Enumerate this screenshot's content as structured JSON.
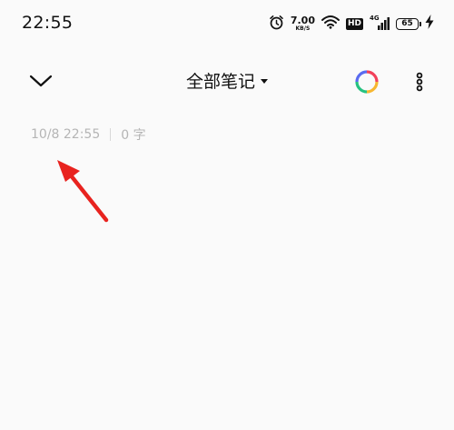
{
  "status_bar": {
    "time": "22:55",
    "net_speed_value": "7.00",
    "net_speed_unit": "KB/S",
    "hd_label": "HD",
    "signal_label": "4G",
    "battery_level": "65",
    "icons": [
      "alarm-icon",
      "wifi-icon",
      "signal-icon",
      "charging-icon"
    ]
  },
  "top_bar": {
    "title": "全部笔记",
    "icons": [
      "chevron-down-icon",
      "theme-color-ring-icon",
      "more-vertical-icon"
    ]
  },
  "note": {
    "date": "10/8 22:55",
    "word_count": "0 字"
  },
  "annotation": {
    "arrow_color": "#e8231f"
  }
}
